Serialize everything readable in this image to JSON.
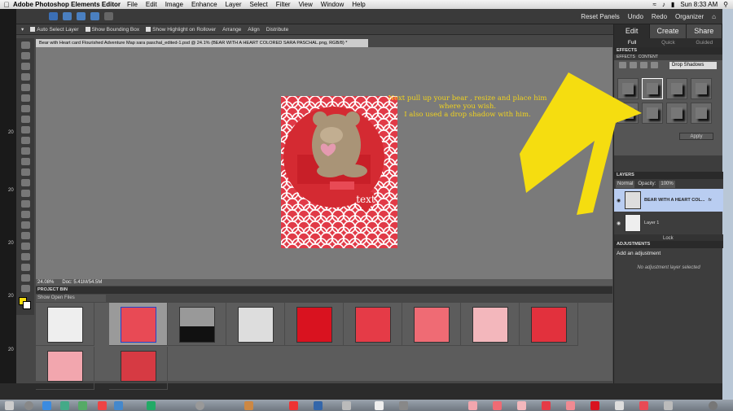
{
  "menubar": {
    "app_name": "Adobe Photoshop Elements Editor",
    "menus": [
      "File",
      "Edit",
      "Image",
      "Enhance",
      "Layer",
      "Select",
      "Filter",
      "View",
      "Window",
      "Help"
    ],
    "clock": "Sun 8:33 AM"
  },
  "appbar": {
    "reset_panels": "Reset Panels",
    "undo": "Undo",
    "redo": "Redo",
    "organizer": "Organizer"
  },
  "options": {
    "auto_select": "Auto Select Layer",
    "bounding_box": "Show Bounding Box",
    "highlight": "Show Highlight on Rollover",
    "arrange": "Arrange",
    "align": "Align",
    "distribute": "Distribute"
  },
  "document": {
    "tab_title": "Bear with Heart card Flourished Adventure Map sara paschal_edited-1.psd @ 24.1% (BEAR WITH A HEART COLORED SARA PASCHAL.png, RGB/8) *",
    "zoom": "24.08%",
    "doc_size": "Doc: 5.41M/54.5M",
    "art_text": "text"
  },
  "instruction": {
    "line1": "Next pull up your bear , resize and place him",
    "line2": "where you wish.",
    "line3": "I also used a drop shadow with him."
  },
  "bin": {
    "header": "PROJECT BIN",
    "select": "Show Open Files",
    "thumbs": [
      "map",
      "bear-card",
      "doc-black",
      "bear",
      "red",
      "red-pattern",
      "pink-pattern",
      "white-pattern",
      "red-pattern2",
      "pink-small",
      "bear-small"
    ]
  },
  "panel": {
    "modes": [
      "Edit",
      "Create",
      "Share"
    ],
    "submodes": [
      "Full",
      "Quick",
      "Guided"
    ],
    "effects_header": "EFFECTS",
    "effects_tabs": [
      "EFFECTS",
      "CONTENT"
    ],
    "effects_dropdown": "Drop Shadows",
    "apply": "Apply",
    "layers_header": "LAYERS",
    "blend": "Normal",
    "opacity_label": "Opacity:",
    "opacity_value": "100%",
    "layer1": "BEAR WITH A HEART COL...",
    "layer2": "Layer 1",
    "lock": "Lock",
    "adjustments_header": "ADJUSTMENTS",
    "adjustments_hint": "Add an adjustment",
    "adjustments_none": "No adjustment layer selected"
  },
  "ruler_labels": [
    "20",
    "20",
    "20",
    "20",
    "20"
  ],
  "colors": {
    "accent_yellow": "#f5dd10",
    "instruction_yellow": "#f0d21e",
    "art_red": "#e84a55"
  }
}
